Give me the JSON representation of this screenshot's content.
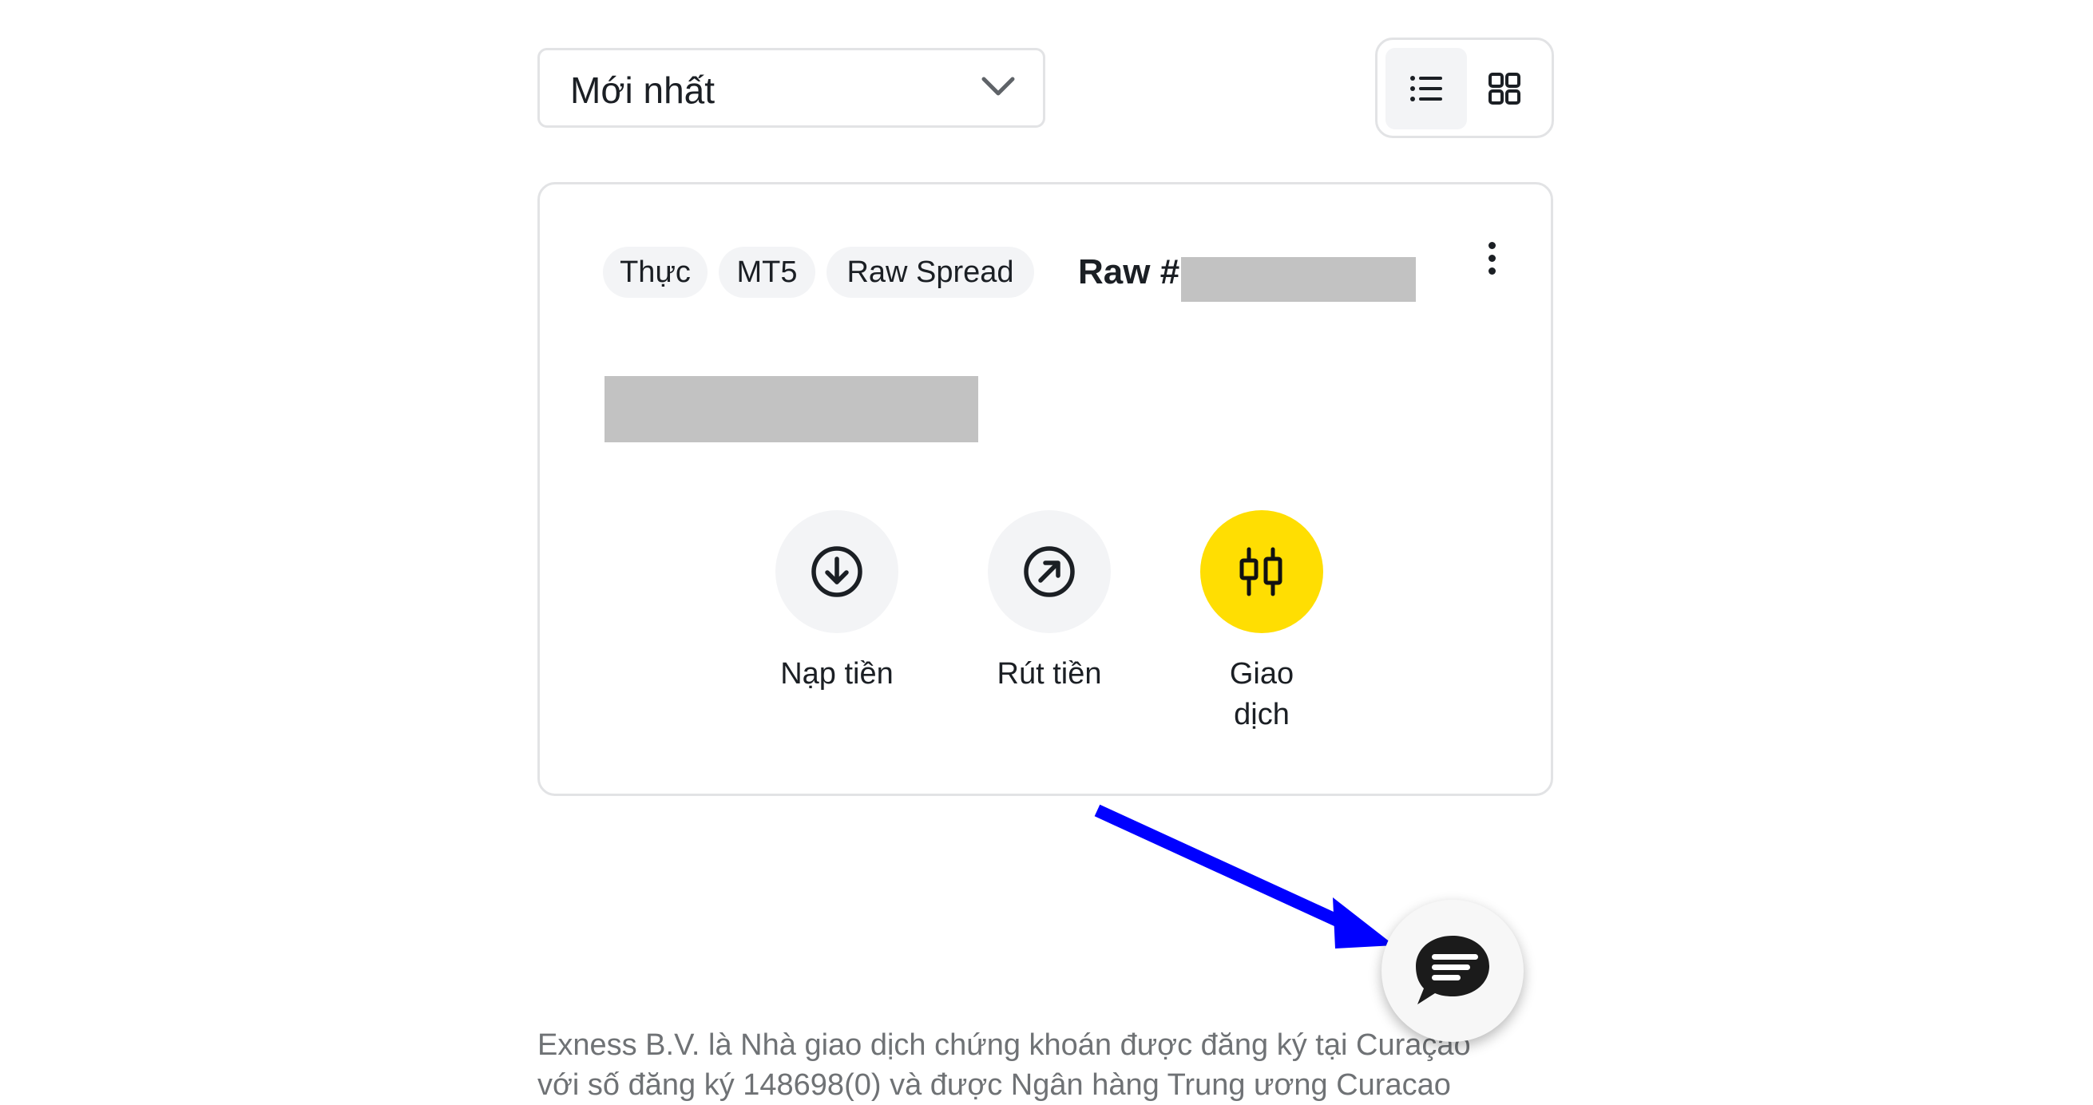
{
  "sort": {
    "selected": "Mới nhất",
    "icon": "chevron-down-icon"
  },
  "view_toggle": {
    "active": "list",
    "options": [
      {
        "name": "list",
        "icon": "list-view-icon"
      },
      {
        "name": "grid",
        "icon": "grid-view-icon"
      }
    ]
  },
  "account_card": {
    "tags": [
      "Thực",
      "MT5",
      "Raw Spread"
    ],
    "account_title": "Raw #",
    "account_number_redacted": true,
    "balance_redacted": true,
    "menu_icon": "more-vertical-icon",
    "actions": [
      {
        "label": "Nạp tiền",
        "icon": "deposit-arrow-down-circle-icon",
        "primary": false
      },
      {
        "label": "Rút tiền",
        "icon": "withdraw-arrow-up-right-circle-icon",
        "primary": false
      },
      {
        "label": "Giao dịch",
        "icon": "trade-candlestick-icon",
        "primary": true
      }
    ]
  },
  "chat": {
    "icon": "chat-bubble-icon"
  },
  "annotation": {
    "type": "arrow",
    "color": "#0000ff",
    "points_to": "chat-button"
  },
  "colors": {
    "primary_yellow": "#ffde02",
    "chip_bg": "#f3f4f6",
    "border": "#e2e3e5",
    "footer_text": "#6f7275",
    "redaction": "#c2c2c2"
  },
  "footer": {
    "line1": "Exness B.V. là Nhà giao dịch chứng khoán được đăng ký tại Curaçao",
    "line2": "với số đăng ký 148698(0) và được Ngân hàng Trung ương Curacao"
  }
}
